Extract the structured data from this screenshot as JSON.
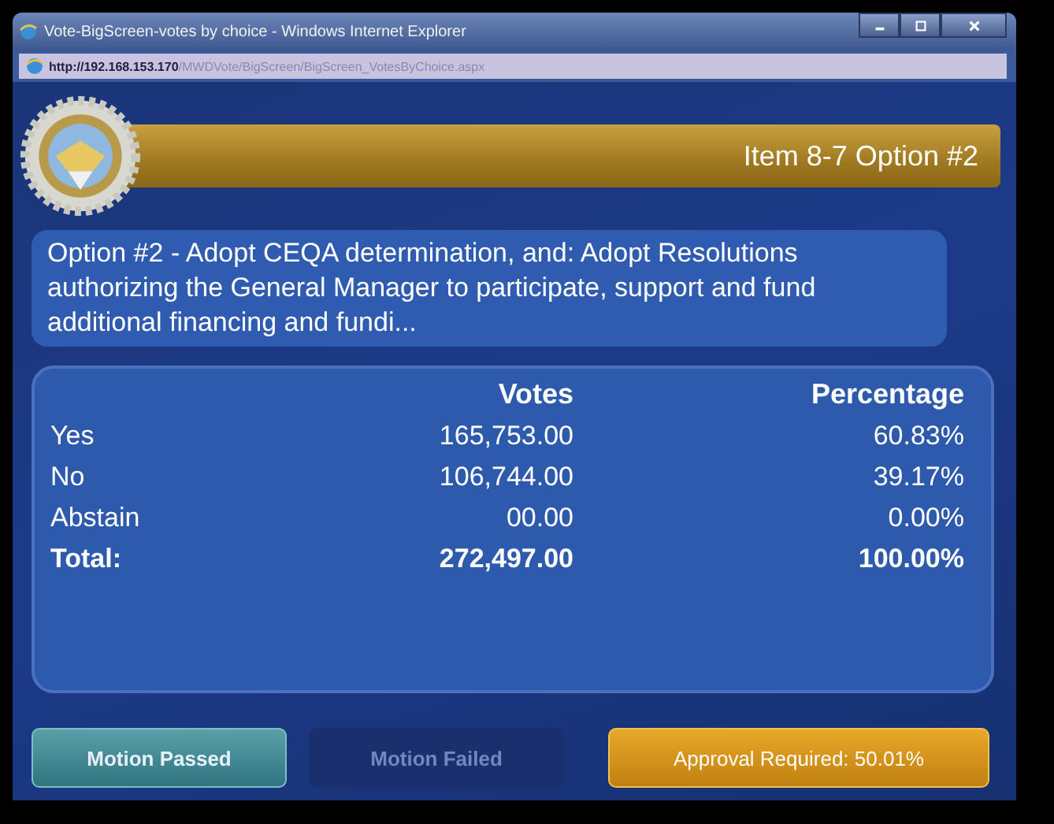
{
  "window": {
    "title": "Vote-BigScreen-votes by choice - Windows Internet Explorer",
    "address_host": "http://192.168.153.170",
    "address_path": "/MWDVote/BigScreen/BigScreen_VotesByChoice.aspx"
  },
  "header": {
    "title": "Item 8-7 Option #2"
  },
  "description": "Option #2 - Adopt CEQA determination, and: Adopt Resolutions authorizing the General Manager to participate, support and fund additional financing and fundi...",
  "table": {
    "columns": [
      "Votes",
      "Percentage"
    ],
    "rows": [
      {
        "kind": "choice",
        "label": "Yes",
        "votes": "165,753.00",
        "percentage": "60.83%"
      },
      {
        "kind": "choice",
        "label": "No",
        "votes": "106,744.00",
        "percentage": "39.17%"
      },
      {
        "kind": "choice",
        "label": "Abstain",
        "votes": "00.00",
        "percentage": "0.00%"
      },
      {
        "kind": "total",
        "label": "Total:",
        "votes": "272,497.00",
        "percentage": "100.00%"
      }
    ]
  },
  "outcomes": [
    {
      "label": "Motion Passed",
      "lit": true
    },
    {
      "label": "Motion Failed",
      "lit": false
    }
  ],
  "approval": "Approval Required: 50.01%"
}
